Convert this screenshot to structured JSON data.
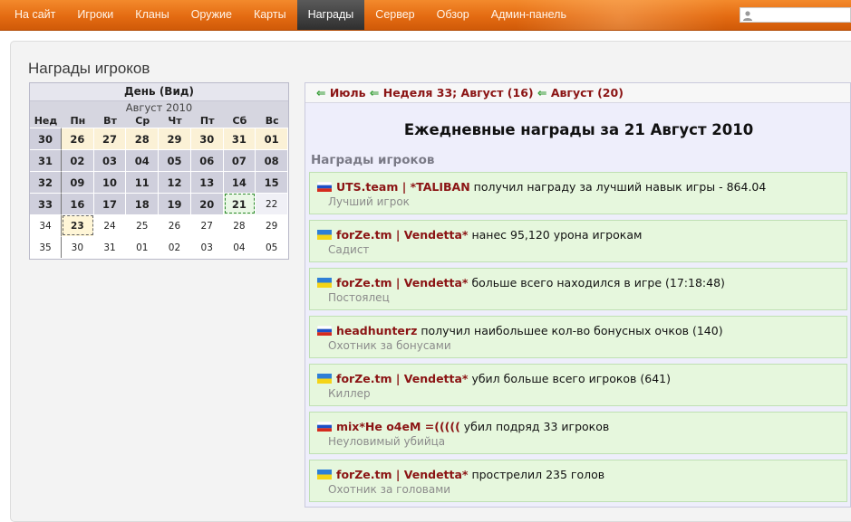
{
  "nav": {
    "items": [
      {
        "label": "На сайт"
      },
      {
        "label": "Игроки"
      },
      {
        "label": "Кланы"
      },
      {
        "label": "Оружие"
      },
      {
        "label": "Карты"
      },
      {
        "label": "Награды",
        "active": true
      },
      {
        "label": "Сервер"
      },
      {
        "label": "Обзор"
      },
      {
        "label": "Админ-панель"
      }
    ],
    "search": {
      "value": "",
      "placeholder": ""
    }
  },
  "page": {
    "title": "Награды игроков"
  },
  "calendar": {
    "header": "День (Вид)",
    "month": "Август 2010",
    "dow": [
      "Нед",
      "Пн",
      "Вт",
      "Ср",
      "Чт",
      "Пт",
      "Сб",
      "Вс"
    ],
    "rows": [
      [
        "30",
        "26",
        "27",
        "28",
        "29",
        "30",
        "31",
        "01"
      ],
      [
        "31",
        "02",
        "03",
        "04",
        "05",
        "06",
        "07",
        "08"
      ],
      [
        "32",
        "09",
        "10",
        "11",
        "12",
        "13",
        "14",
        "15"
      ],
      [
        "33",
        "16",
        "17",
        "18",
        "19",
        "20",
        "21",
        "22"
      ],
      [
        "34",
        "23",
        "24",
        "25",
        "26",
        "27",
        "28",
        "29"
      ],
      [
        "35",
        "30",
        "31",
        "01",
        "02",
        "03",
        "04",
        "05"
      ]
    ]
  },
  "nav_crumbs": {
    "month_prev": "Июль",
    "week": "Неделя 33; Август (16)",
    "day": "Август (20)"
  },
  "day_title": "Ежедневные награды за 21 Август 2010",
  "section_title": "Награды игроков",
  "colors": {
    "accent_orange": "#e46b12",
    "player_red": "#8b1414",
    "award_bg": "#e6f7dd",
    "arrow_green": "#2f9a2f"
  },
  "awards": [
    {
      "flag": "ru",
      "player": "UTS.team | *TALIBAN",
      "text": "получил награду за лучший навык игры - 864.04",
      "name": "Лучший игрок"
    },
    {
      "flag": "ua",
      "player": "forZe.tm | Vendetta*",
      "text": "нанес 95,120 урона игрокам",
      "name": "Садист"
    },
    {
      "flag": "ua",
      "player": "forZe.tm | Vendetta*",
      "text": "больше всего находился в игре (17:18:48)",
      "name": "Постоялец"
    },
    {
      "flag": "ru",
      "player": "headhunterz",
      "text": "получил наибольшее кол-во бонусных очков (140)",
      "name": "Охотник за бонусами"
    },
    {
      "flag": "ua",
      "player": "forZe.tm | Vendetta*",
      "text": "убил больше всего игроков (641)",
      "name": "Киллер"
    },
    {
      "flag": "ru",
      "player": "mix*He o4eM =(((((",
      "text": "убил подряд 33 игроков",
      "name": "Неуловимый убийца"
    },
    {
      "flag": "ua",
      "player": "forZe.tm | Vendetta*",
      "text": "прострелил 235 голов",
      "name": "Охотник за головами"
    }
  ]
}
